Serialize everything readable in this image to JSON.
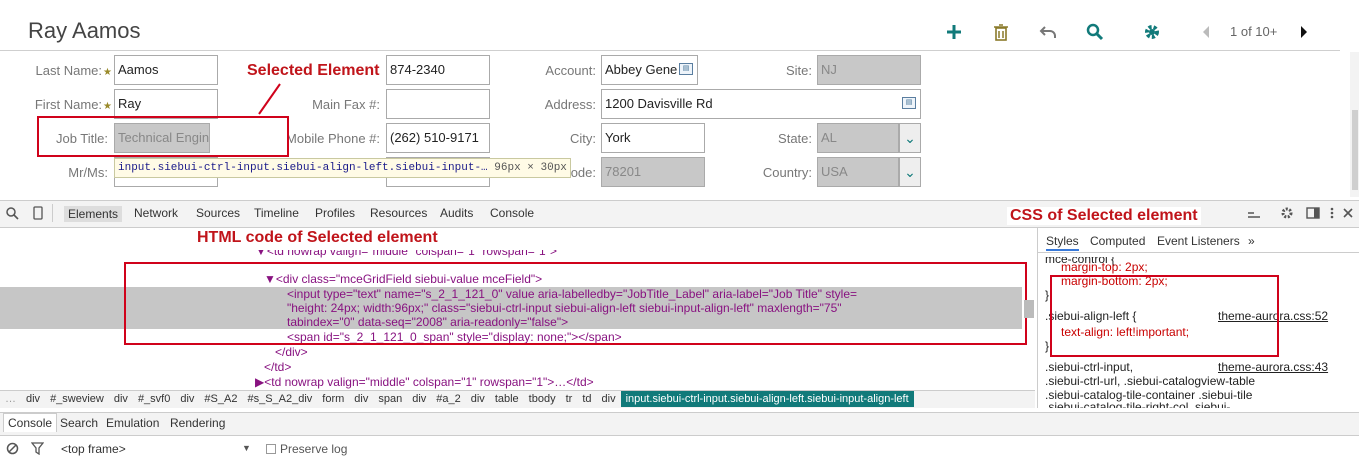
{
  "record": {
    "title": "Ray Aamos",
    "pager": "1 of 10+"
  },
  "toolbar": {
    "icons": [
      "add-icon",
      "delete-icon",
      "undo-icon",
      "search-icon",
      "settings-icon",
      "prev-record-icon",
      "next-record-icon"
    ]
  },
  "form": {
    "last_name_label": "Last Name:",
    "last_name_value": "Aamos",
    "first_name_label": "First Name:",
    "first_name_value": "Ray",
    "job_title_label": "Job Title:",
    "job_title_value": "Technical Engin",
    "mr_ms_label": "Mr/Ms:",
    "phone_value": "874-2340",
    "main_fax_label": "Main Fax #:",
    "mobile_phone_label": "Mobile Phone #:",
    "mobile_phone_value": "(262) 510-9171",
    "account_label": "Account:",
    "account_value": "Abbey Gene",
    "address_label": "Address:",
    "address_value": "1200 Davisville Rd",
    "city_label": "City:",
    "city_value": "York",
    "postal_label": "ode:",
    "postal_value": "78201",
    "site_label": "Site:",
    "site_value": "NJ",
    "state_label": "State:",
    "state_value": "AL",
    "country_label": "Country:",
    "country_value": "USA",
    "required_mark": "★",
    "picker_glyph": "▤",
    "dropdown_glyph": "⌄"
  },
  "annotations": {
    "selected_element": "Selected Element",
    "html_code": "HTML code of Selected element",
    "css_of_selected": "CSS of Selected element"
  },
  "tooltip": {
    "selector": "input.siebui-ctrl-input.siebui-align-left.siebui-input-…",
    "size": "96px × 30px"
  },
  "devtools": {
    "tabs": [
      "Elements",
      "Network",
      "Sources",
      "Timeline",
      "Profiles",
      "Resources",
      "Audits",
      "Console"
    ],
    "side_tabs": [
      "Styles",
      "Computed",
      "Event Listeners",
      "»"
    ],
    "code_lines": [
      "▼<td nowrap valign=\"middle\" colspan=\"1\" rowspan=\"1\">",
      "▼<div class=\"mceGridField siebui-value mceField\">",
      "<input type=\"text\" name=\"s_2_1_121_0\" value aria-labelledby=\"JobTitle_Label\" aria-label=\"Job Title\" style=",
      "\"height: 24px; width:96px;\" class=\"siebui-ctrl-input siebui-align-left siebui-input-align-left\" maxlength=\"75\"",
      "tabindex=\"0\" data-seq=\"2008\" aria-readonly=\"false\">",
      "<span id=\"s_2_1_121_0_span\" style=\"display: none;\"></span>",
      "</div>",
      "</td>",
      "▶<td nowrap valign=\"middle\" colspan=\"1\" rowspan=\"1\">…</td>"
    ],
    "css_lines": {
      "partial_head": "mce-control {",
      "margin_top": "margin-top: 2px;",
      "margin_bottom": "margin-bottom: 2px;",
      "close1": "}",
      "rule_selector": ".siebui-align-left {",
      "rule_source": "theme-aurora.css:52",
      "rule_prop": "text-align: left!important;",
      "close2": "}",
      "rule2_selector": ".siebui-ctrl-input,",
      "rule2_source": "theme-aurora.css:43",
      "rule2_line2": ".siebui-ctrl-url, .siebui-catalogview-table",
      "rule2_line3": ".siebui-catalog-tile-container .siebui-tile",
      "rule2_line4": ".siebui-catalog-tile-right-col .siebui-"
    },
    "breadcrumbs": [
      "…",
      "div",
      "#_sweview",
      "div",
      "#_svf0",
      "div",
      "#S_A2",
      "#s_S_A2_div",
      "form",
      "div",
      "span",
      "div",
      "#a_2",
      "div",
      "table",
      "tbody",
      "tr",
      "td",
      "div",
      "input.siebui-ctrl-input.siebui-align-left.siebui-input-align-left"
    ],
    "drawer_tabs": [
      "Console",
      "Search",
      "Emulation",
      "Rendering"
    ],
    "frame_select": "<top frame>",
    "preserve_log": "Preserve log"
  },
  "colors": {
    "accent": "#117a7a",
    "annotation_red": "#d0021b"
  }
}
